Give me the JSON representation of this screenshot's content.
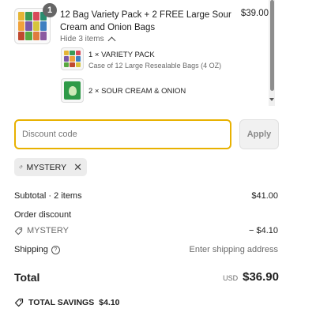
{
  "line_item": {
    "quantity": "1",
    "title": "12 Bag Variety Pack + 2 FREE Large Sour Cream and Onion Bags",
    "price": "$39.00",
    "hide_items_label": "Hide 3 items",
    "components": [
      {
        "line": "1 × VARIETY PACK",
        "detail": "Case of 12 Large Resealable Bags (4 OZ)"
      },
      {
        "line": "2 × SOUR CREAM & ONION"
      }
    ]
  },
  "discount": {
    "placeholder": "Discount code",
    "value": "",
    "apply_label": "Apply",
    "applied_code": "MYSTERY"
  },
  "summary": {
    "subtotal_label": "Subtotal · 2 items",
    "subtotal_value": "$41.00",
    "order_discount_label": "Order discount",
    "discount_code": "MYSTERY",
    "discount_value": "− $4.10",
    "shipping_label": "Shipping",
    "shipping_value": "Enter shipping address",
    "total_label": "Total",
    "currency": "USD",
    "total_value": "$36.90",
    "total_savings_label": "TOTAL SAVINGS",
    "total_savings_value": "$4.10"
  },
  "colors": {
    "focus_border": "#e8b100",
    "chip_bg": "#ececec",
    "bag_green": "#2f9a48"
  }
}
